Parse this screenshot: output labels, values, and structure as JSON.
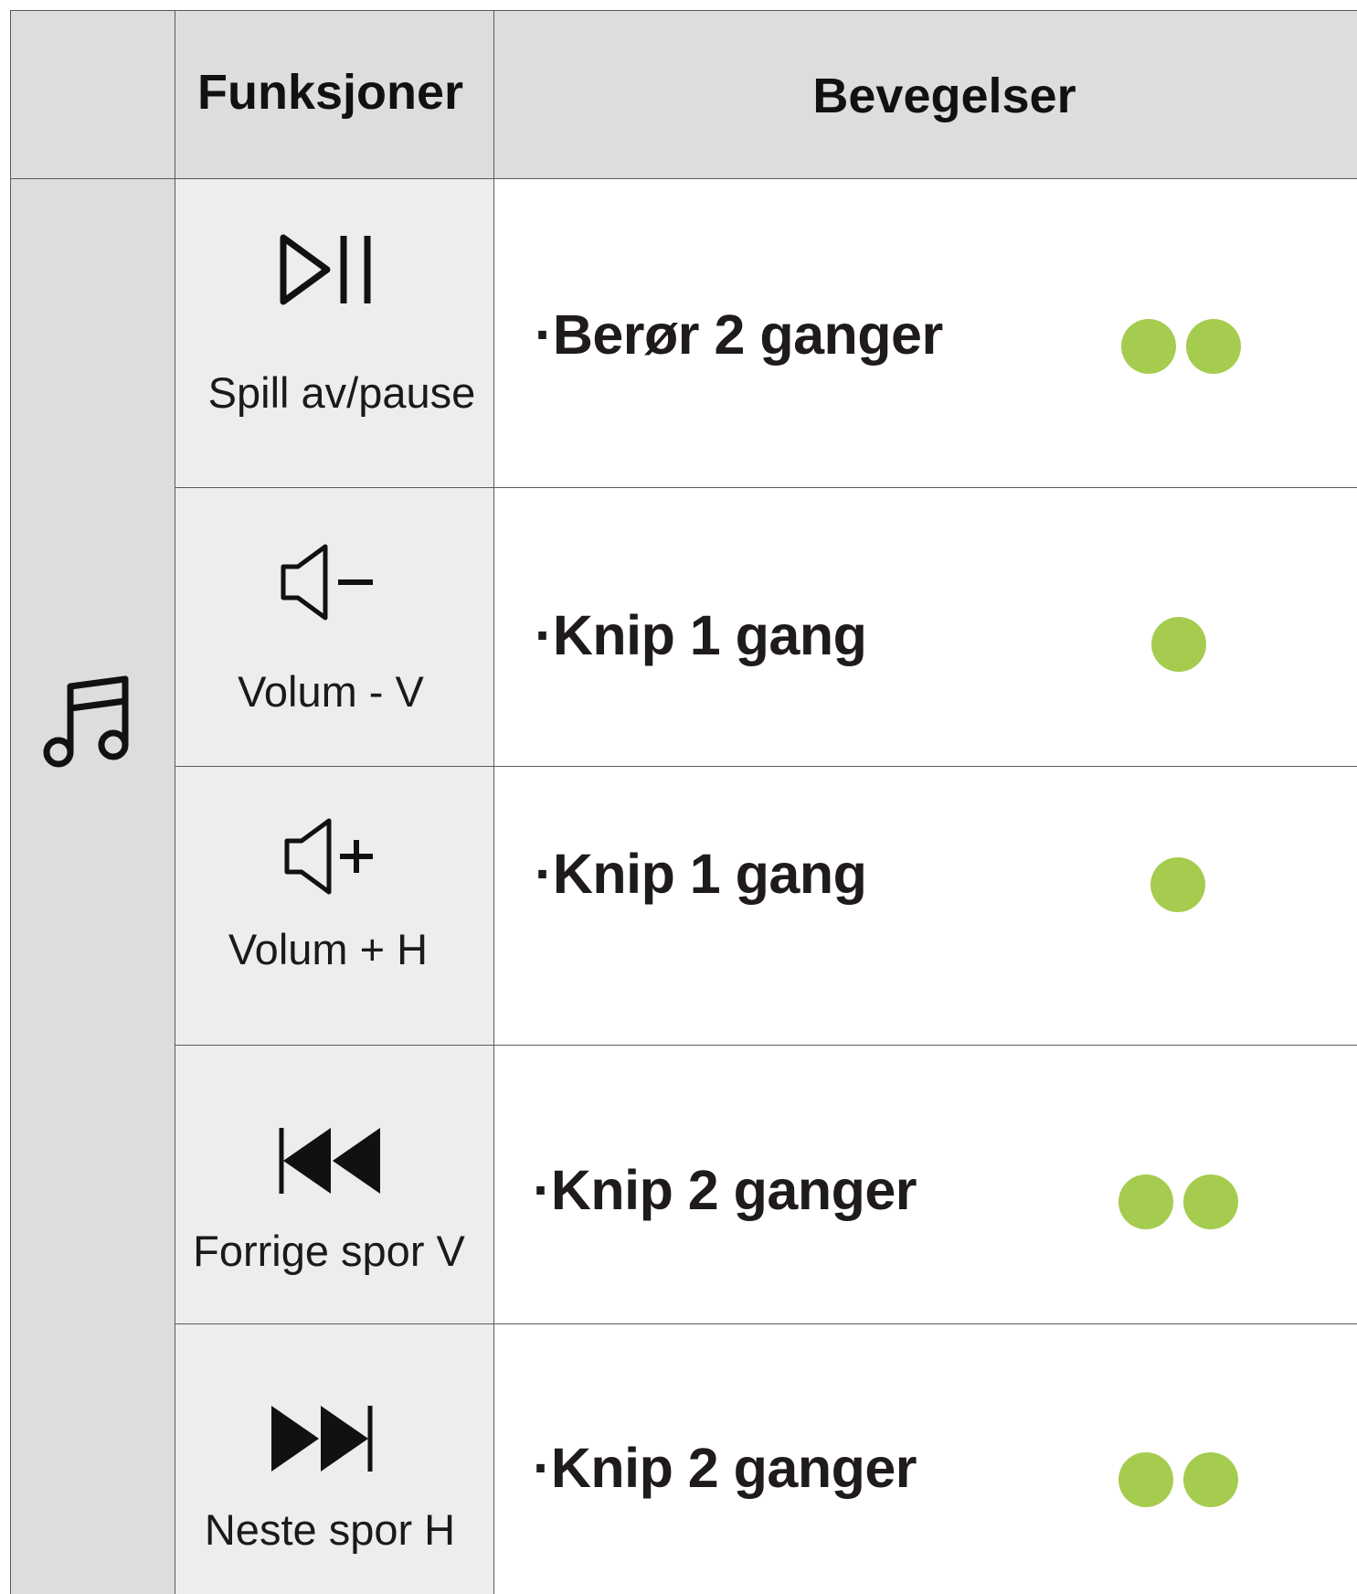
{
  "header": {
    "functions": "Funksjoner",
    "gestures": "Bevegelser"
  },
  "accent_color": "#a5cc4e",
  "rows": [
    {
      "icon": "play-pause-icon",
      "function": "Spill av/pause",
      "gesture": "·Berør 2 ganger",
      "dots": 2
    },
    {
      "icon": "volume-down-icon",
      "function": "Volum - V",
      "gesture": "·Knip 1 gang",
      "dots": 1
    },
    {
      "icon": "volume-up-icon",
      "function": "Volum + H",
      "gesture": "·Knip 1 gang",
      "dots": 1
    },
    {
      "icon": "previous-track-icon",
      "function": "Forrige spor V",
      "gesture": "·Knip 2 ganger",
      "dots": 2
    },
    {
      "icon": "next-track-icon",
      "function": "Neste spor H",
      "gesture": "·Knip 2 ganger",
      "dots": 2
    }
  ],
  "section_icon": "music-note-icon"
}
